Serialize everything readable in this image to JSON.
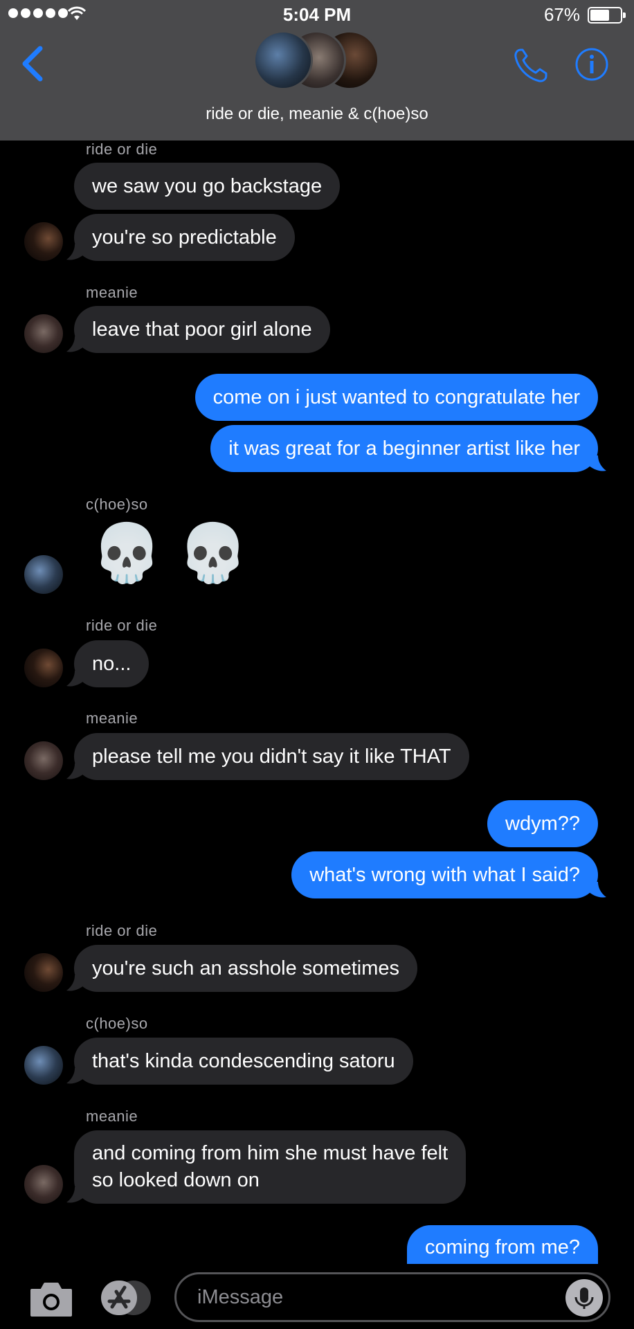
{
  "status_bar": {
    "time": "5:04 PM",
    "battery": "67%",
    "battery_level": 0.67
  },
  "header": {
    "title": "ride or die, meanie & c(hoe)so",
    "accent_color": "#1f7cff"
  },
  "messages": [
    {
      "sender": "ride or die",
      "text": "we saw you go backstage",
      "dir": "in"
    },
    {
      "sender": "ride or die",
      "text": "you're so predictable",
      "dir": "in"
    },
    {
      "sender": "meanie",
      "text": "leave that poor girl alone",
      "dir": "in"
    },
    {
      "sender": "me",
      "text": "come on i just wanted to congratulate her",
      "dir": "out"
    },
    {
      "sender": "me",
      "text": "it was great for a beginner artist like her",
      "dir": "out"
    },
    {
      "sender": "c(hoe)so",
      "text": "💀 💀",
      "dir": "in",
      "emoji_only": true
    },
    {
      "sender": "ride or die",
      "text": "no...",
      "dir": "in"
    },
    {
      "sender": "meanie",
      "text": "please tell me you didn't say it like THAT",
      "dir": "in"
    },
    {
      "sender": "me",
      "text": "wdym??",
      "dir": "out"
    },
    {
      "sender": "me",
      "text": "what's wrong with what I said?",
      "dir": "out"
    },
    {
      "sender": "ride or die",
      "text": "you're such an asshole sometimes",
      "dir": "in"
    },
    {
      "sender": "c(hoe)so",
      "text": "that's kinda condescending satoru",
      "dir": "in"
    },
    {
      "sender": "meanie",
      "text": "and coming from him she must have felt so looked down on",
      "lines": [
        "and coming from him she must have felt",
        "so looked down on"
      ],
      "dir": "in"
    },
    {
      "sender": "me",
      "text": "coming from me?",
      "dir": "out"
    }
  ],
  "input": {
    "placeholder": "iMessage"
  },
  "colors": {
    "incoming_bubble": "#27272a",
    "outgoing_bubble": "#1f7cff",
    "header_bg": "#4a4a4c"
  }
}
